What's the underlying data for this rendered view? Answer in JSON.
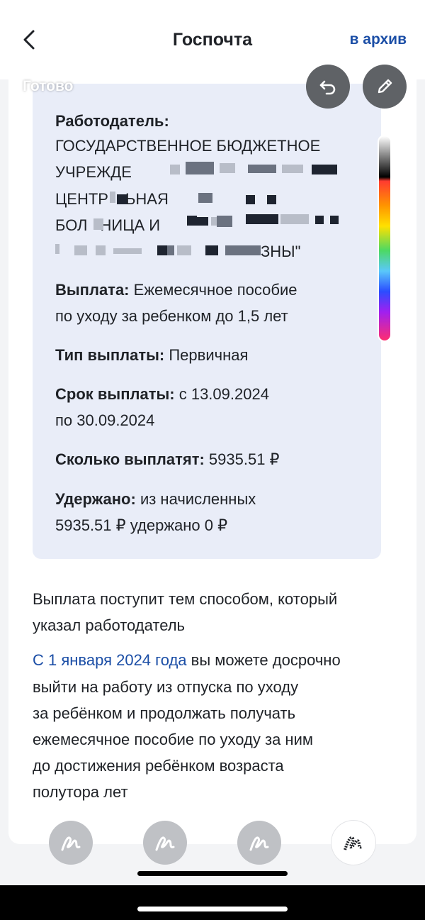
{
  "header": {
    "title": "Госпочта",
    "archive_label": "в архив"
  },
  "overlay": {
    "done_label": "Готово"
  },
  "info": {
    "employer_label": "Работодатель:",
    "employer_line1": "ГОСУДАРСТВЕННОЕ БЮДЖЕТНОЕ",
    "employer_line2": "УЧРЕЖДЕ",
    "employer_line2b": "\"",
    "employer_line3": "ЦЕНТР",
    "employer_line3b": "ЬНАЯ",
    "employer_line4": "БОЛ",
    "employer_line4b": "НИЦА И",
    "employer_line5b": "ЗНЫ\"",
    "payment_label": "Выплата:",
    "payment_value_1": "Ежемесячное пособие",
    "payment_value_2": "по уходу за ребенком до 1,5 лет",
    "type_label": "Тип выплаты:",
    "type_value": "Первичная",
    "period_label": "Срок выплаты:",
    "period_value_1": "с 13.09.2024",
    "period_value_2": "по 30.09.2024",
    "amount_label": "Сколько выплатят:",
    "amount_value": "5935.51 ₽",
    "withheld_label": "Удержано:",
    "withheld_value_1": "из начисленных",
    "withheld_value_2": "5935.51 ₽ удержано 0 ₽"
  },
  "body": {
    "notice_1": "Выплата поступит тем способом, который",
    "notice_2": "указал работодатель",
    "link_text": "С 1 января 2024 года",
    "para_1": " вы можете досрочно",
    "para_2": "выйти на работу из отпуска по уходу",
    "para_3": "за ребёнком и продолжать получать",
    "para_4": "ежемесячное пособие по уходу за ним",
    "para_5": "до достижения ребёнком возраста",
    "para_6": "полутора лет"
  },
  "colors": {
    "accent": "#1b4ea6",
    "info_box": "#e9edf8",
    "tool_button": "#bfc1c5"
  }
}
